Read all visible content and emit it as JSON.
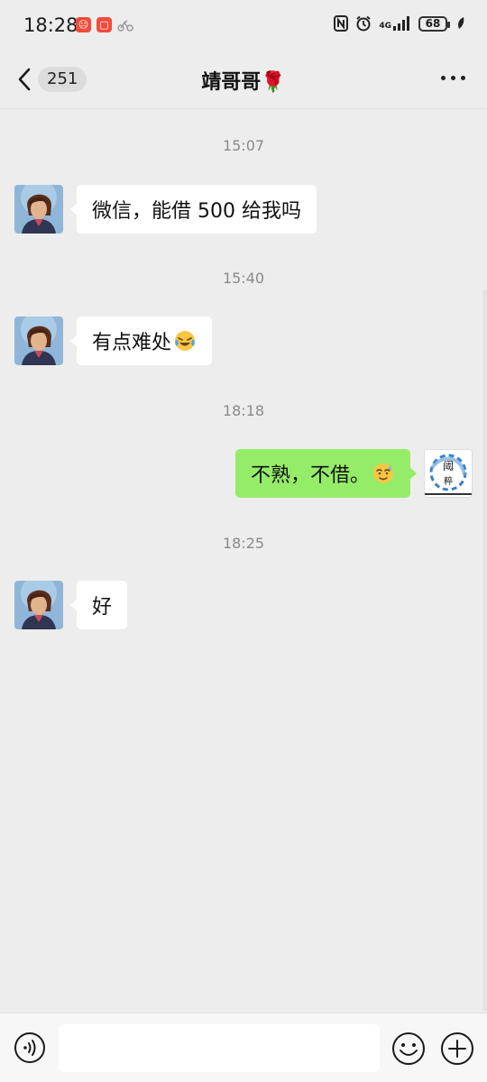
{
  "status_bar": {
    "time": "18:28",
    "network": "4G",
    "battery": "68"
  },
  "nav": {
    "unread_count": "251",
    "title": "靖哥哥🌹"
  },
  "messages": [
    {
      "timestamp": "15:07",
      "side": "left",
      "text": "微信，能借 500 给我吗",
      "emoji": ""
    },
    {
      "timestamp": "15:40",
      "side": "left",
      "text": "有点难处",
      "emoji": "laughing-crying-emoji"
    },
    {
      "timestamp": "18:18",
      "side": "right",
      "text": "不熟，不借。",
      "emoji": "sweat-smile-emoji"
    },
    {
      "timestamp": "18:25",
      "side": "left",
      "text": "好",
      "emoji": ""
    }
  ],
  "input": {
    "value": "",
    "placeholder": ""
  },
  "colors": {
    "background": "#ededed",
    "bubble_received": "#ffffff",
    "bubble_sent": "#95ec69"
  },
  "icons": {
    "back": "chevron-left-icon",
    "more": "more-dots-icon",
    "voice": "voice-icon",
    "emoji": "emoji-icon",
    "plus": "plus-icon"
  }
}
